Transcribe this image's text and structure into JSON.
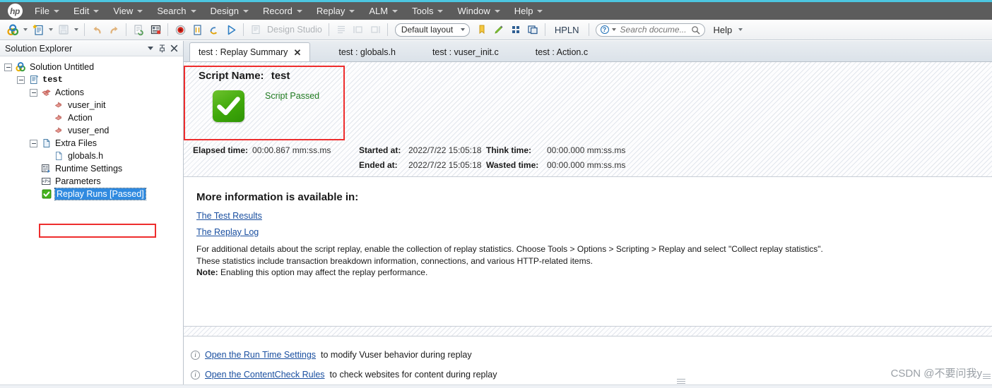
{
  "window": {
    "brand_logo": "hp-logo",
    "accent_color": "#4cc6e0",
    "menubar_color": "#5c5c5c"
  },
  "menu": {
    "items": [
      {
        "label": "File",
        "mnemonic": "F"
      },
      {
        "label": "Edit",
        "mnemonic": "E"
      },
      {
        "label": "View",
        "mnemonic": "V"
      },
      {
        "label": "Search",
        "mnemonic": "S"
      },
      {
        "label": "Design",
        "mnemonic": "D"
      },
      {
        "label": "Record",
        "mnemonic": "R"
      },
      {
        "label": "Replay",
        "mnemonic": "p"
      },
      {
        "label": "ALM",
        "mnemonic": "A"
      },
      {
        "label": "Tools",
        "mnemonic": "T"
      },
      {
        "label": "Window",
        "mnemonic": "W"
      },
      {
        "label": "Help",
        "mnemonic": "H"
      }
    ]
  },
  "toolbar": {
    "design_studio_label": "Design Studio",
    "layout_combo_value": "Default layout",
    "hpln_label": "HPLN",
    "search_placeholder": "Search docume...",
    "help_label": "Help",
    "icons": [
      "new-solution-icon",
      "new-script-icon",
      "save-icon",
      "undo-icon",
      "redo-icon",
      "compile-icon",
      "script-details-icon",
      "record-icon",
      "replay-script-icon",
      "replay-refresh-icon",
      "run-icon",
      "design-studio-icon",
      "steps-icon",
      "snapshot-left-icon",
      "snapshot-right-icon",
      "bookmark-icon",
      "highlighter-icon",
      "grid-icon",
      "windows-icon"
    ]
  },
  "explorer": {
    "title": "Solution Explorer",
    "header_buttons": [
      "dropdown-icon",
      "pin-icon",
      "close-icon"
    ],
    "tree": [
      {
        "label": "Solution Untitled",
        "icon": "solution-icon",
        "depth": 0,
        "expander": "minus",
        "selected": false,
        "bold": false
      },
      {
        "label": "test",
        "icon": "script-icon",
        "depth": 1,
        "expander": "minus",
        "selected": false,
        "bold": true
      },
      {
        "label": "Actions",
        "icon": "actions-icon",
        "depth": 2,
        "expander": "minus",
        "selected": false,
        "bold": false
      },
      {
        "label": "vuser_init",
        "icon": "action-icon",
        "depth": 3,
        "expander": "none",
        "selected": false,
        "bold": false
      },
      {
        "label": "Action",
        "icon": "action-icon",
        "depth": 3,
        "expander": "none",
        "selected": false,
        "bold": false
      },
      {
        "label": "vuser_end",
        "icon": "action-icon",
        "depth": 3,
        "expander": "none",
        "selected": false,
        "bold": false
      },
      {
        "label": "Extra Files",
        "icon": "folder-file-icon",
        "depth": 2,
        "expander": "minus",
        "selected": false,
        "bold": false
      },
      {
        "label": "globals.h",
        "icon": "file-icon",
        "depth": 3,
        "expander": "none",
        "selected": false,
        "bold": false
      },
      {
        "label": "Runtime Settings",
        "icon": "runtime-settings-icon",
        "depth": 2,
        "expander": "none",
        "selected": false,
        "bold": false
      },
      {
        "label": "Parameters",
        "icon": "parameters-icon",
        "depth": 2,
        "expander": "none",
        "selected": false,
        "bold": false
      },
      {
        "label": "Replay Runs [Passed]",
        "icon": "green-check-icon",
        "depth": 2,
        "expander": "none",
        "selected": true,
        "bold": false
      }
    ]
  },
  "tabs": [
    {
      "label": "test : Replay Summary",
      "active": true,
      "closable": true
    },
    {
      "label": "test : globals.h",
      "active": false,
      "closable": false
    },
    {
      "label": "test : vuser_init.c",
      "active": false,
      "closable": false
    },
    {
      "label": "test : Action.c",
      "active": false,
      "closable": false
    }
  ],
  "summary": {
    "script_name_label": "Script Name:",
    "script_name_value": "test",
    "status_text": "Script Passed",
    "status_color": "#1f7a1f",
    "status_icon": "green-check-icon",
    "stats": [
      {
        "key": "Elapsed time:",
        "value": "00:00.867 mm:ss.ms"
      },
      {
        "key": "Started at:",
        "value": "2022/7/22 15:05:18"
      },
      {
        "key": "Think time:",
        "value": "00:00.000 mm:ss.ms"
      },
      {
        "key": "Ended at:",
        "value": "2022/7/22 15:05:18"
      },
      {
        "key": "Wasted time:",
        "value": "00:00.000 mm:ss.ms"
      }
    ]
  },
  "more_info": {
    "heading": "More information is available in:",
    "links": [
      "The Test Results",
      "The Replay Log"
    ],
    "paragraph_line1": "For additional details about the script replay, enable the collection of replay statistics. Choose Tools > Options > Scripting > Replay and select \"Collect replay statistics\".",
    "paragraph_line2": "These statistics include transaction breakdown information, connections, and various HTTP-related items.",
    "note_label": "Note:",
    "note_text": " Enabling this option may affect the replay performance."
  },
  "bottom_links": [
    {
      "link": "Open the Run Time Settings",
      "suffix": " to modify Vuser behavior during replay",
      "icon": "info-icon"
    },
    {
      "link": "Open the ContentCheck Rules",
      "suffix": " to check websites for content during replay",
      "icon": "info-icon"
    }
  ],
  "watermark": "CSDN @不要问我y"
}
